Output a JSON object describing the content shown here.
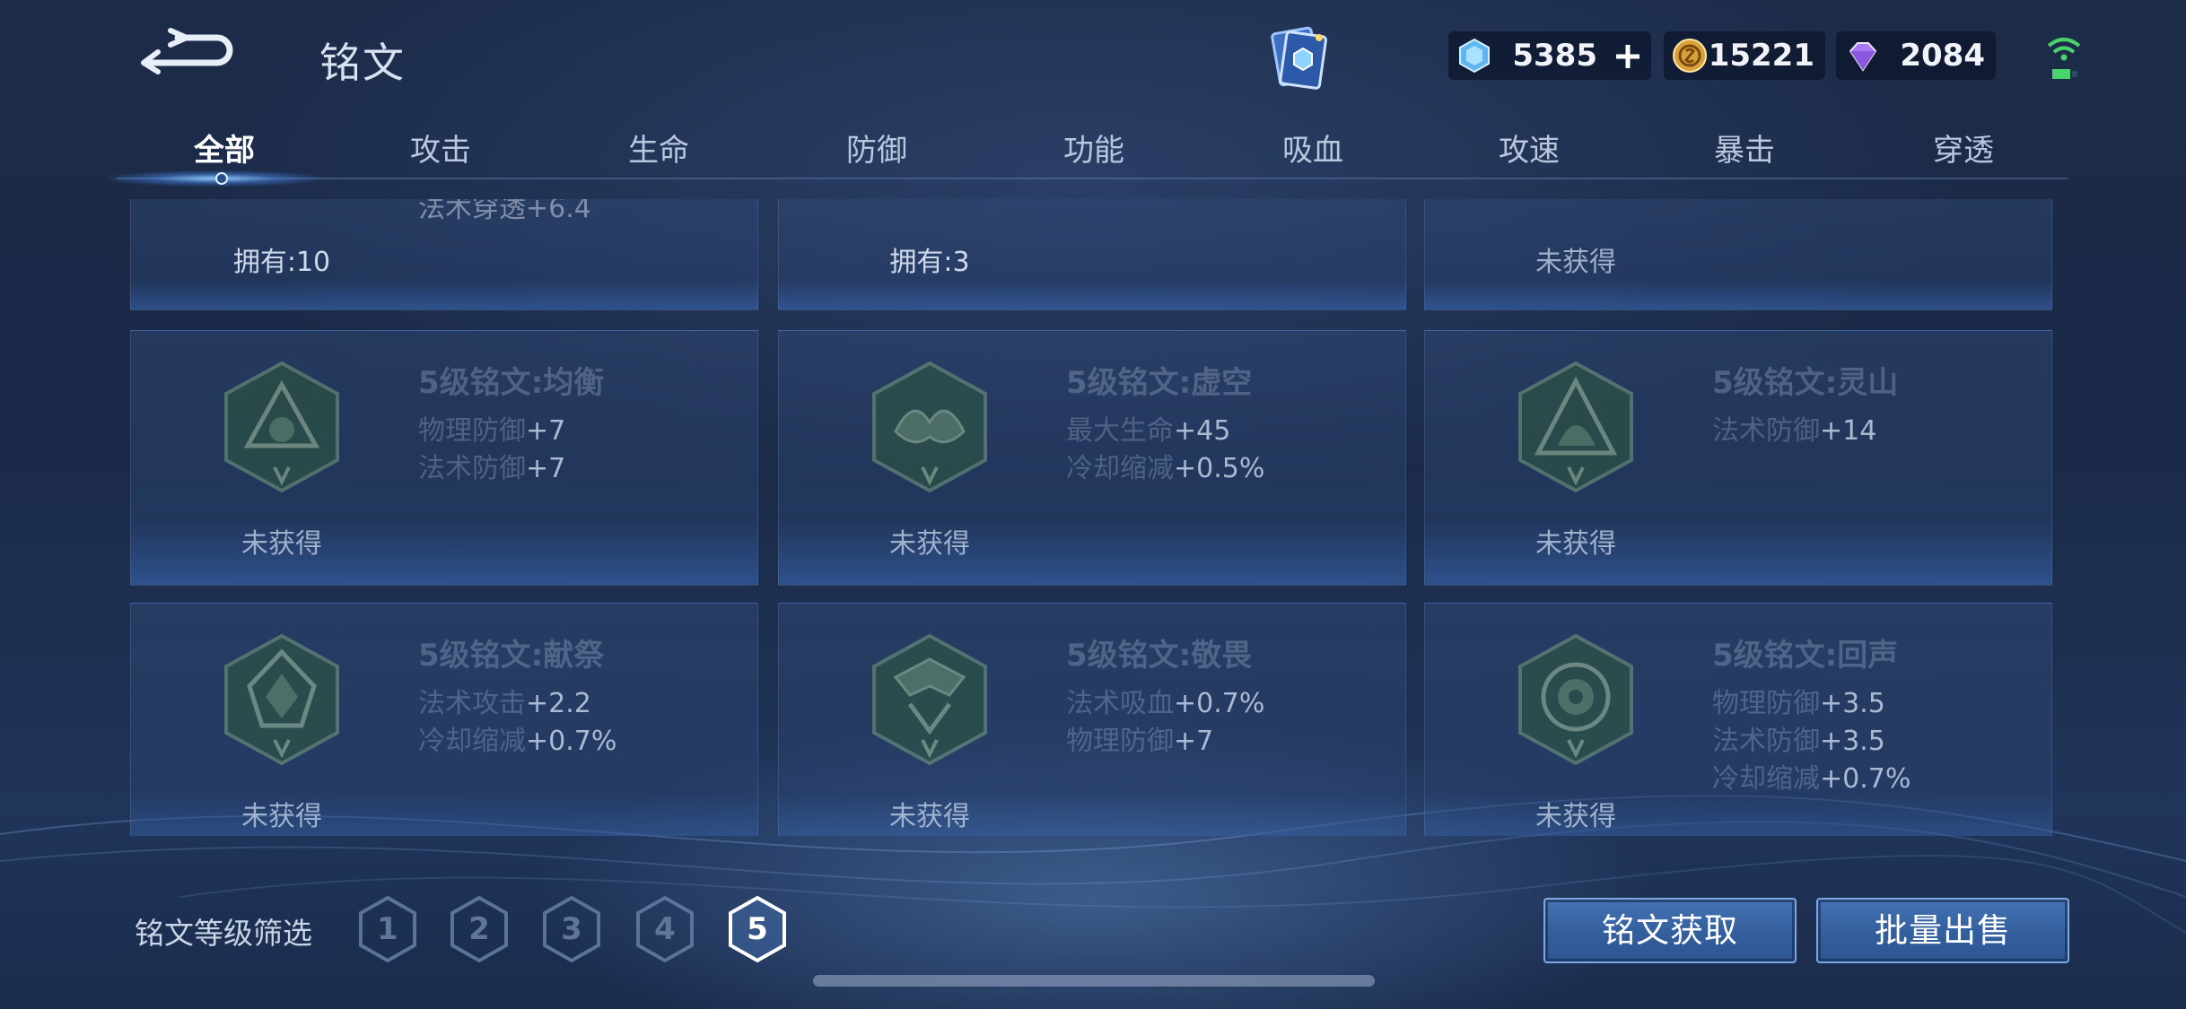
{
  "header": {
    "title": "铭文",
    "currencies": [
      {
        "name": "diamond",
        "value": "5385",
        "icon": "diamond-icon",
        "color": "#7fd0ff"
      },
      {
        "name": "gold",
        "value": "15221",
        "icon": "gold-coin-icon",
        "color": "#e2b54a"
      },
      {
        "name": "gem",
        "value": "2084",
        "icon": "purple-gem-icon",
        "color": "#b58cf0"
      }
    ]
  },
  "tabs": [
    "全部",
    "攻击",
    "生命",
    "防御",
    "功能",
    "吸血",
    "攻速",
    "暴击",
    "穿透"
  ],
  "active_tab": 0,
  "partial_row": [
    {
      "owned": "拥有:10",
      "cut_text": "法术穿透+6.4"
    },
    {
      "owned": "拥有:3"
    },
    {
      "owned": "未获得"
    }
  ],
  "cards": [
    {
      "name": "5级铭文:均衡",
      "stats": [
        {
          "label": "物理防御",
          "value": "+7"
        },
        {
          "label": "法术防御",
          "value": "+7"
        }
      ],
      "owned": "未获得",
      "icon": "balance-emblem-icon"
    },
    {
      "name": "5级铭文:虚空",
      "stats": [
        {
          "label": "最大生命",
          "value": "+45"
        },
        {
          "label": "冷却缩减",
          "value": "+0.5%"
        }
      ],
      "owned": "未获得",
      "icon": "void-emblem-icon"
    },
    {
      "name": "5级铭文:灵山",
      "stats": [
        {
          "label": "法术防御",
          "value": "+14"
        }
      ],
      "owned": "未获得",
      "icon": "spirit-mountain-emblem-icon"
    },
    {
      "name": "5级铭文:献祭",
      "stats": [
        {
          "label": "法术攻击",
          "value": "+2.2"
        },
        {
          "label": "冷却缩减",
          "value": "+0.7%"
        }
      ],
      "owned": "未获得",
      "icon": "sacrifice-emblem-icon"
    },
    {
      "name": "5级铭文:敬畏",
      "stats": [
        {
          "label": "法术吸血",
          "value": "+0.7%"
        },
        {
          "label": "物理防御",
          "value": "+7"
        }
      ],
      "owned": "未获得",
      "icon": "awe-emblem-icon"
    },
    {
      "name": "5级铭文:回声",
      "stats": [
        {
          "label": "物理防御",
          "value": "+3.5"
        },
        {
          "label": "法术防御",
          "value": "+3.5"
        },
        {
          "label": "冷却缩减",
          "value": "+0.7%"
        }
      ],
      "owned": "未获得",
      "icon": "echo-emblem-icon"
    }
  ],
  "filter": {
    "label": "铭文等级筛选",
    "levels": [
      "1",
      "2",
      "3",
      "4",
      "5"
    ],
    "selected": "5"
  },
  "buttons": {
    "get": "铭文获取",
    "sell": "批量出售"
  }
}
